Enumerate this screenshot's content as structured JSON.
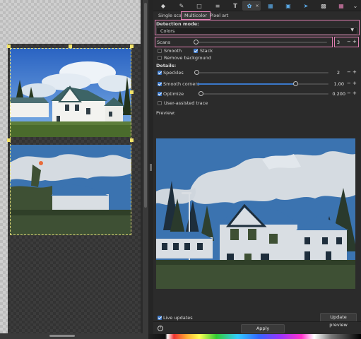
{
  "canvas": {
    "photo_original": "color photo of a white farmhouse with green roof under a blue sky with clouds",
    "photo_traced": "multicolor traced preview of the same farmhouse"
  },
  "toolbar": {
    "icons": [
      "layers-icon",
      "edit-icon",
      "document-icon",
      "align-icon",
      "text-icon",
      "trace-bitmap-icon",
      "swatches-icon",
      "objects-icon",
      "export-icon",
      "symbols-icon",
      "document-properties-icon",
      "more-icon"
    ],
    "active": "trace-bitmap-icon"
  },
  "tabs": [
    {
      "label": "Single scan",
      "active": false
    },
    {
      "label": "Multicolor",
      "active": true
    },
    {
      "label": "Pixel art",
      "active": false
    }
  ],
  "detection": {
    "label": "Detection mode:",
    "value": "Colors"
  },
  "scans": {
    "label": "Scans",
    "value": "3",
    "minus": "−",
    "plus": "+",
    "slider_fraction": 0.0
  },
  "options": {
    "smooth": {
      "label": "Smooth",
      "checked": false
    },
    "stack": {
      "label": "Stack",
      "checked": true
    },
    "remove_background": {
      "label": "Remove background",
      "checked": false
    }
  },
  "details": {
    "label": "Details:",
    "speckles": {
      "label": "Speckles",
      "checked": true,
      "value": "2",
      "slider_fraction": 0.0
    },
    "smooth_corners": {
      "label": "Smooth corners",
      "checked": true,
      "value": "1.00",
      "slider_fraction": 0.75
    },
    "optimize": {
      "label": "Optimize",
      "checked": true,
      "value": "0.200",
      "slider_fraction": 0.0
    }
  },
  "user_assisted": {
    "label": "User-assisted trace",
    "checked": false
  },
  "preview": {
    "label": "Preview:"
  },
  "live_updates": {
    "label": "Live updates",
    "checked": true
  },
  "update_preview_button": "Update preview",
  "apply_button": "Apply",
  "colors": {
    "accent": "#3b78c9",
    "highlight_frame": "#e07fb2",
    "trace_blue": "#3b73b0",
    "trace_white": "#d9dee3",
    "trace_green": "#3e5034",
    "trace_navy": "#1e2e3c"
  }
}
